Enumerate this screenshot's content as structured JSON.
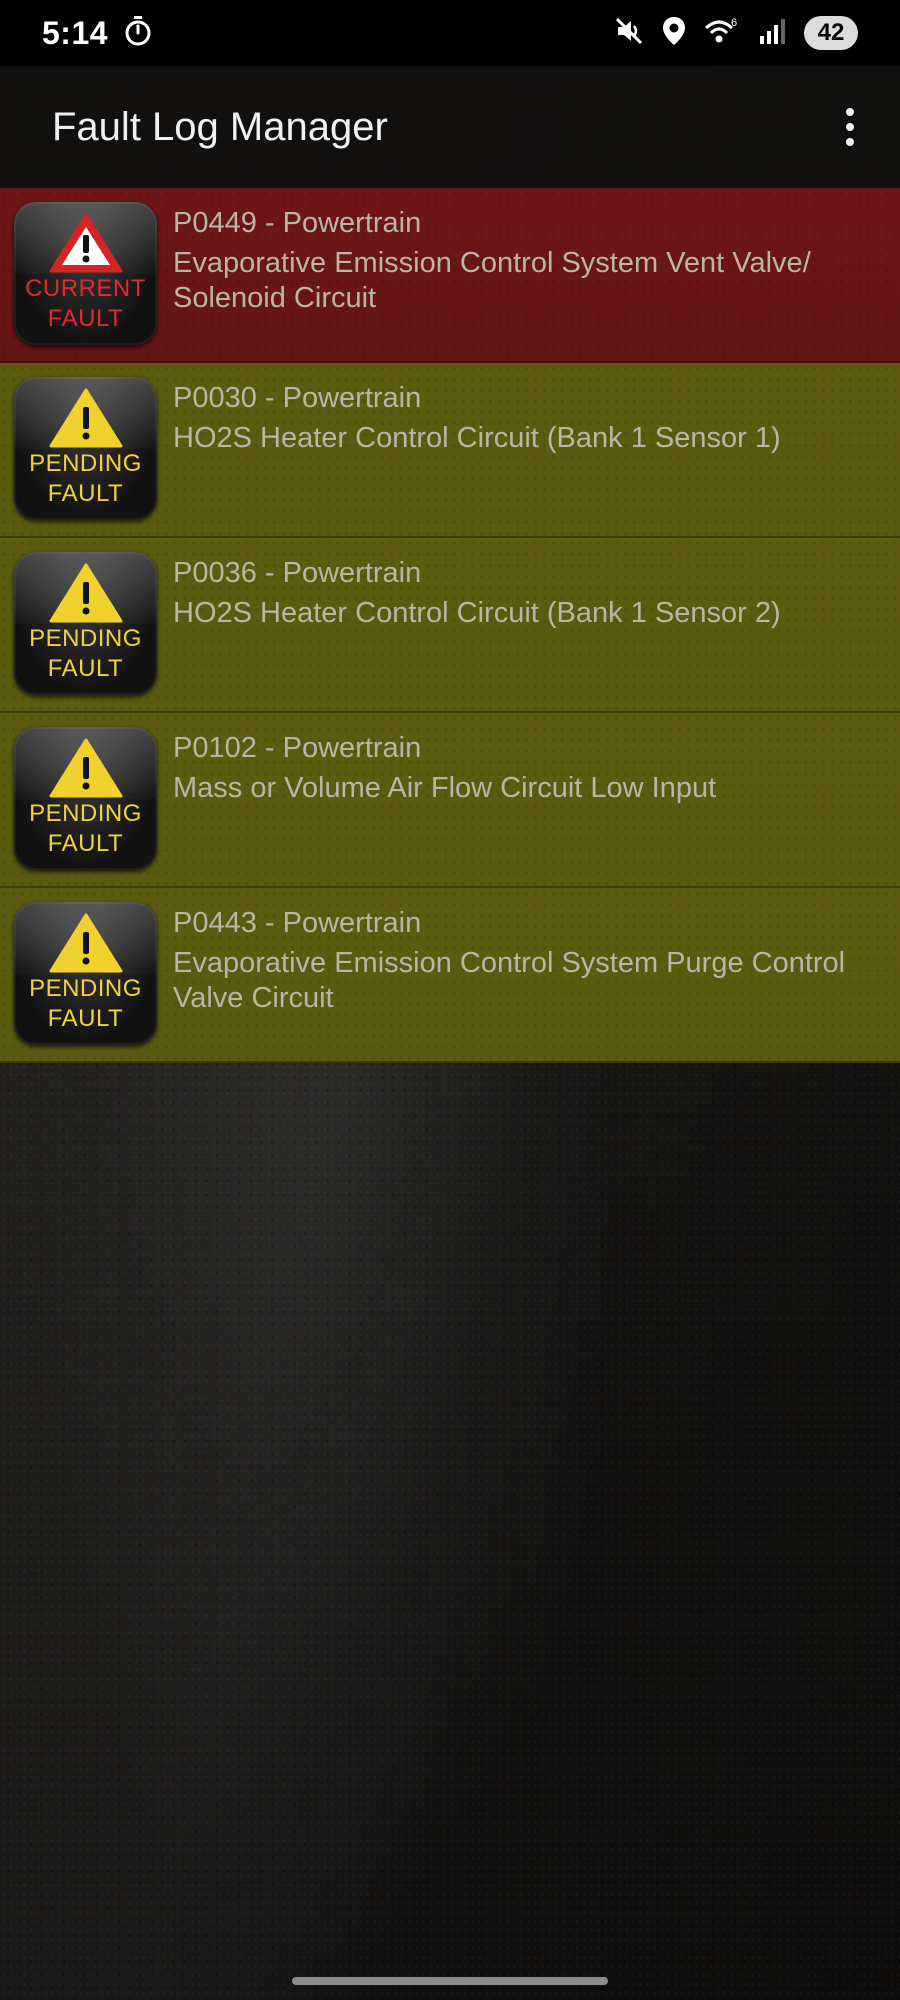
{
  "status_bar": {
    "time": "5:14",
    "battery": "42",
    "icons": [
      "timer-icon",
      "mute-icon",
      "location-icon",
      "wifi-6-icon",
      "signal-icon"
    ]
  },
  "app_bar": {
    "title": "Fault Log Manager",
    "menu_icon": "more-vert-icon"
  },
  "faults": [
    {
      "status": "current",
      "badge_line1": "CURRENT",
      "badge_line2": "FAULT",
      "code": "P0449 - Powertrain",
      "description": "Evaporative Emission Control System Vent Valve/ Solenoid Circuit",
      "color": "#6b1616"
    },
    {
      "status": "pending",
      "badge_line1": "PENDING",
      "badge_line2": "FAULT",
      "code": "P0030 - Powertrain",
      "description": "HO2S Heater Control Circuit (Bank 1 Sensor 1)",
      "color": "#5c5a10"
    },
    {
      "status": "pending",
      "badge_line1": "PENDING",
      "badge_line2": "FAULT",
      "code": "P0036 - Powertrain",
      "description": "HO2S Heater Control Circuit (Bank 1 Sensor 2)",
      "color": "#5c5a10"
    },
    {
      "status": "pending",
      "badge_line1": "PENDING",
      "badge_line2": "FAULT",
      "code": "P0102 - Powertrain",
      "description": "Mass or Volume Air Flow Circuit Low Input",
      "color": "#5c5a10"
    },
    {
      "status": "pending",
      "badge_line1": "PENDING",
      "badge_line2": "FAULT",
      "code": "P0443 - Powertrain",
      "description": "Evaporative Emission Control System Purge Control Valve Circuit",
      "color": "#5c5a10"
    }
  ]
}
